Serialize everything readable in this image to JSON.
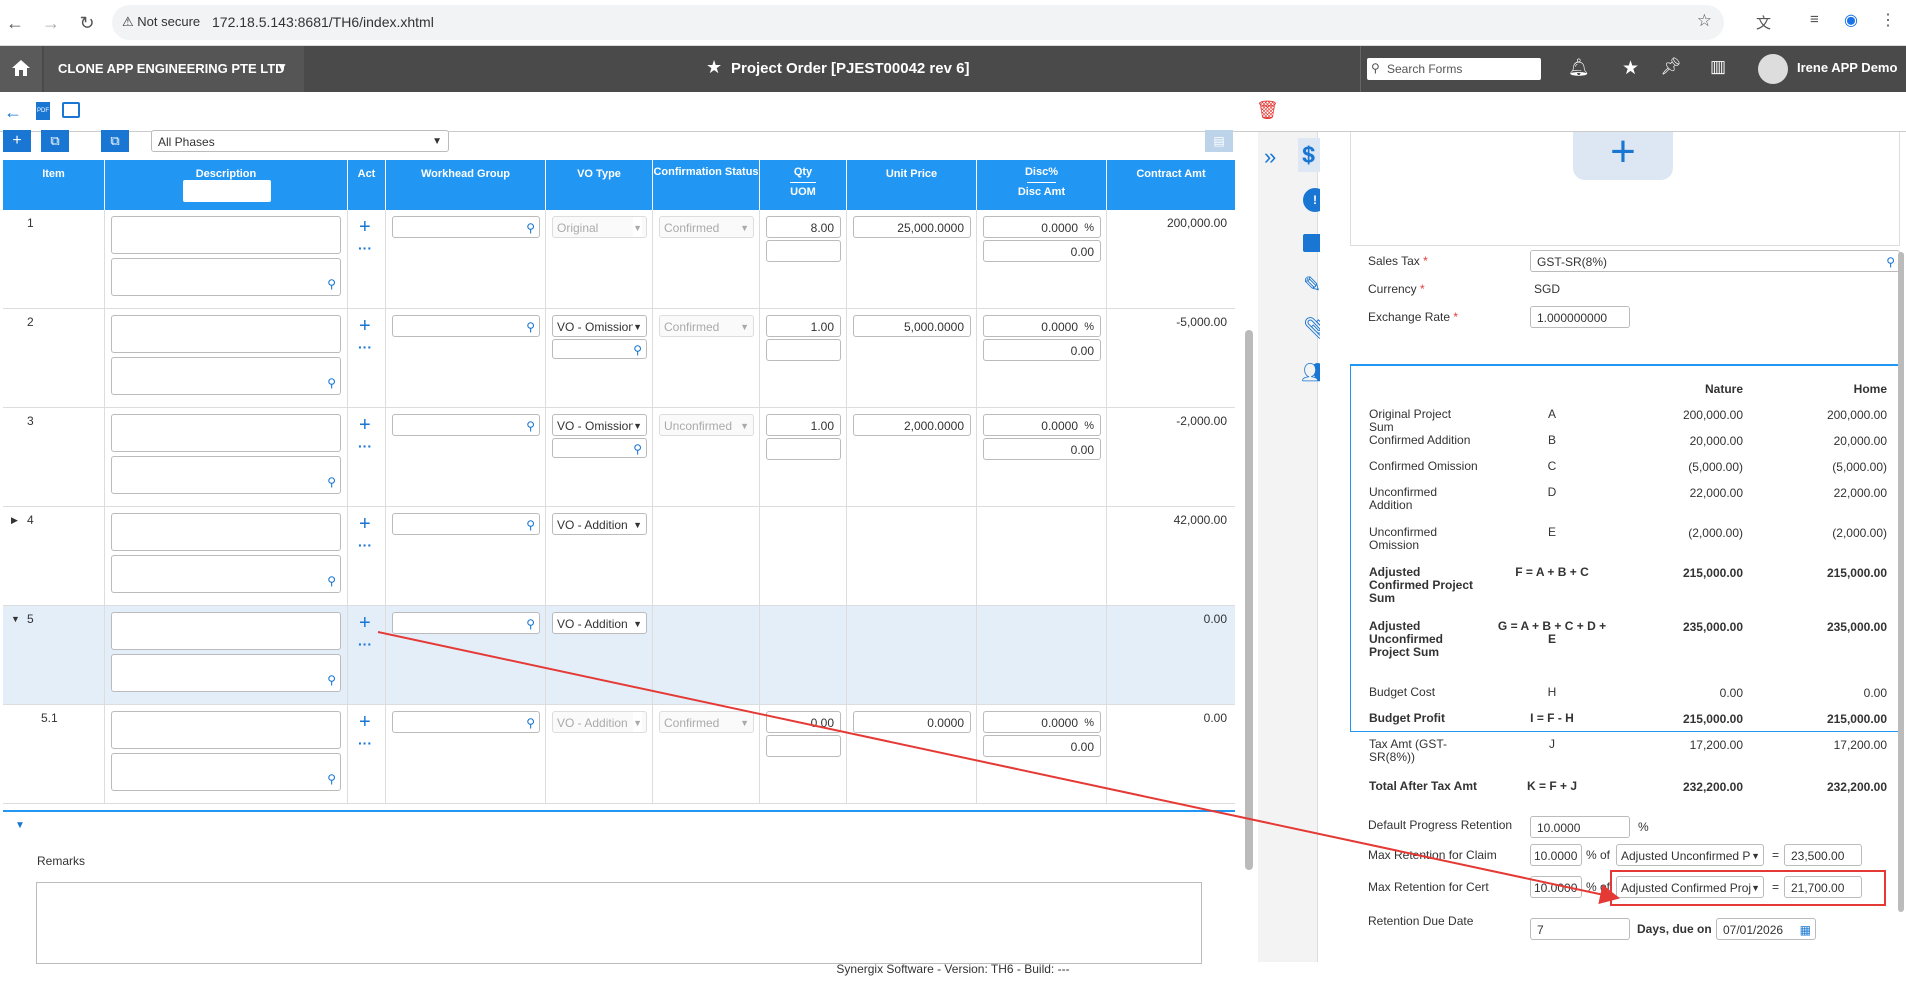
{
  "browser": {
    "security": "Not secure",
    "url": "172.18.5.143:8681/TH6/index.xhtml"
  },
  "header": {
    "company": "CLONE APP ENGINEERING PTE LTD",
    "title": "Project Order [PJEST00042 rev 6]",
    "search_placeholder": "Search Forms",
    "user": "Irene APP Demo"
  },
  "phase": {
    "selected": "All Phases"
  },
  "grid": {
    "headers": {
      "item": "Item",
      "description": "Description",
      "act": "Act",
      "workhead": "Workhead Group",
      "vo_type": "VO Type",
      "confirmation": "Confirmation Status",
      "qty": "Qty",
      "uom": "UOM",
      "unit_price": "Unit Price",
      "disc": "Disc%",
      "disc_amt": "Disc Amt",
      "contract_amt": "Contract Amt"
    },
    "rows": [
      {
        "item": "1",
        "vo_type": "Original",
        "status": "Confirmed",
        "qty": "8.00",
        "price": "25,000.0000",
        "disc": "0.0000",
        "disc_amt": "0.00",
        "amt": "200,000.00"
      },
      {
        "item": "2",
        "vo_type": "VO - Omission",
        "status": "Confirmed",
        "qty": "1.00",
        "price": "5,000.0000",
        "disc": "0.0000",
        "disc_amt": "0.00",
        "amt": "-5,000.00"
      },
      {
        "item": "3",
        "vo_type": "VO - Omission",
        "status": "Unconfirmed",
        "qty": "1.00",
        "price": "2,000.0000",
        "disc": "0.0000",
        "disc_amt": "0.00",
        "amt": "-2,000.00"
      },
      {
        "item": "4",
        "vo_type": "VO - Addition",
        "status": "",
        "qty": "",
        "price": "",
        "disc": "",
        "disc_amt": "",
        "amt": "42,000.00"
      },
      {
        "item": "5",
        "vo_type": "VO - Addition",
        "status": "",
        "qty": "",
        "price": "",
        "disc": "",
        "disc_amt": "",
        "amt": "0.00"
      },
      {
        "item": "5.1",
        "vo_type": "VO - Addition",
        "status": "Confirmed",
        "qty": "0.00",
        "price": "0.0000",
        "disc": "0.0000",
        "disc_amt": "0.00",
        "amt": "0.00"
      }
    ],
    "percent": "%"
  },
  "remarks": {
    "label": "Remarks"
  },
  "right": {
    "sales_tax_label": "Sales Tax",
    "sales_tax": "GST-SR(8%)",
    "currency_label": "Currency",
    "currency": "SGD",
    "exchange_label": "Exchange Rate",
    "exchange": "1.000000000",
    "summary_headers": {
      "nature": "Nature",
      "home": "Home"
    },
    "summary": [
      {
        "label": "Original Project Sum",
        "code": "A",
        "nature": "200,000.00",
        "home": "200,000.00"
      },
      {
        "label": "Confirmed Addition",
        "code": "B",
        "nature": "20,000.00",
        "home": "20,000.00"
      },
      {
        "label": "Confirmed Omission",
        "code": "C",
        "nature": "(5,000.00)",
        "home": "(5,000.00)"
      },
      {
        "label": "Unconfirmed Addition",
        "code": "D",
        "nature": "22,000.00",
        "home": "22,000.00"
      },
      {
        "label": "Unconfirmed Omission",
        "code": "E",
        "nature": "(2,000.00)",
        "home": "(2,000.00)"
      },
      {
        "label": "Adjusted Confirmed Project Sum",
        "code": "F = A + B + C",
        "nature": "215,000.00",
        "home": "215,000.00"
      },
      {
        "label": "Adjusted Unconfirmed Project Sum",
        "code": "G = A + B + C + D + E",
        "nature": "235,000.00",
        "home": "235,000.00"
      },
      {
        "label": "Budget Cost",
        "code": "H",
        "nature": "0.00",
        "home": "0.00"
      },
      {
        "label": "Budget Profit",
        "code": "I = F - H",
        "nature": "215,000.00",
        "home": "215,000.00"
      },
      {
        "label": "Tax Amt (GST-SR(8%))",
        "code": "J",
        "nature": "17,200.00",
        "home": "17,200.00"
      },
      {
        "label": "Total After Tax Amt",
        "code": "K = F + J",
        "nature": "232,200.00",
        "home": "232,200.00"
      }
    ],
    "default_retention_label": "Default Progress Retention",
    "default_retention": "10.0000",
    "max_claim_label": "Max Retention for Claim",
    "max_claim_pct": "10.0000",
    "of": "% of",
    "max_claim_base": "Adjusted Unconfirmed P",
    "max_claim_value": "23,500.00",
    "max_cert_label": "Max Retention for Cert",
    "max_cert_pct": "10.0000",
    "max_cert_base": "Adjusted Confirmed Proj",
    "max_cert_value": "21,700.00",
    "due_label": "Retention Due Date",
    "due_days": "7",
    "days_due_on": "Days, due on",
    "due_date": "07/01/2026",
    "equals": "="
  },
  "footer": "Synergix Software - Version: TH6 - Build: ---",
  "colors": {
    "accent": "#2196f3",
    "header_bg": "#4a4a4a",
    "annotation": "#e53935"
  }
}
